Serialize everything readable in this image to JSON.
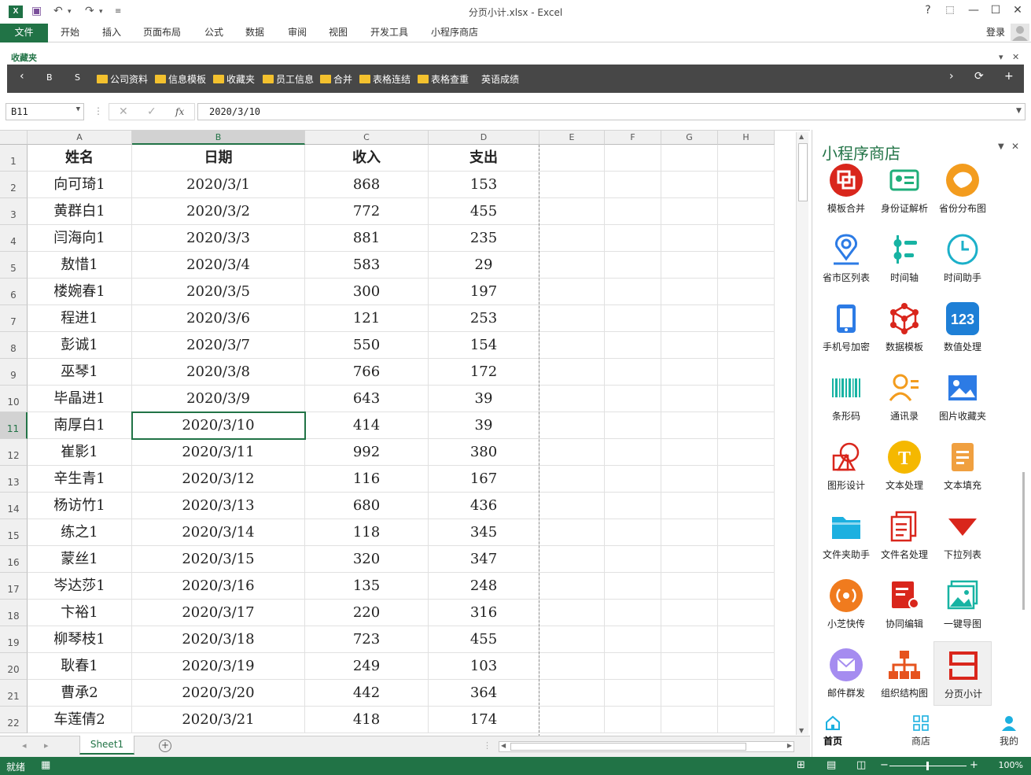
{
  "window": {
    "title": "分页小计.xlsx - Excel",
    "controls": [
      "?",
      "⬚",
      "—",
      "☐",
      "✕"
    ]
  },
  "ribbon": {
    "file": "文件",
    "tabs": [
      "开始",
      "插入",
      "页面布局",
      "公式",
      "数据",
      "审阅",
      "视图",
      "开发工具",
      "小程序商店"
    ],
    "login": "登录"
  },
  "favorites": {
    "label": "收藏夹",
    "buttons": [
      "‹",
      "B",
      "S"
    ],
    "items": [
      "公司资料",
      "信息模板",
      "收藏夹",
      "员工信息",
      "合并",
      "表格连结",
      "表格查重",
      "英语成绩"
    ],
    "right_buttons": [
      "›",
      "⟳",
      "+"
    ]
  },
  "formula_bar": {
    "name_box": "B11",
    "cancel": "✕",
    "confirm": "✓",
    "fx": "fx",
    "value": "2020/3/10"
  },
  "sheet": {
    "columns": [
      "A",
      "B",
      "C",
      "D",
      "E",
      "F",
      "G",
      "H"
    ],
    "selected_column": "B",
    "selected_row": 11,
    "active_cell": "B11",
    "header": [
      "姓名",
      "日期",
      "收入",
      "支出"
    ],
    "rows": [
      [
        "向可琦1",
        "2020/3/1",
        "868",
        "153"
      ],
      [
        "黄群白1",
        "2020/3/2",
        "772",
        "455"
      ],
      [
        "闫海向1",
        "2020/3/3",
        "881",
        "235"
      ],
      [
        "敖惜1",
        "2020/3/4",
        "583",
        "29"
      ],
      [
        "楼婉春1",
        "2020/3/5",
        "300",
        "197"
      ],
      [
        "程进1",
        "2020/3/6",
        "121",
        "253"
      ],
      [
        "彭诚1",
        "2020/3/7",
        "550",
        "154"
      ],
      [
        "巫琴1",
        "2020/3/8",
        "766",
        "172"
      ],
      [
        "毕晶进1",
        "2020/3/9",
        "643",
        "39"
      ],
      [
        "南厚白1",
        "2020/3/10",
        "414",
        "39"
      ],
      [
        "崔影1",
        "2020/3/11",
        "992",
        "380"
      ],
      [
        "辛生青1",
        "2020/3/12",
        "116",
        "167"
      ],
      [
        "杨访竹1",
        "2020/3/13",
        "680",
        "436"
      ],
      [
        "练之1",
        "2020/3/14",
        "118",
        "345"
      ],
      [
        "蒙丝1",
        "2020/3/15",
        "320",
        "347"
      ],
      [
        "岑达莎1",
        "2020/3/16",
        "135",
        "248"
      ],
      [
        "卞裕1",
        "2020/3/17",
        "220",
        "316"
      ],
      [
        "柳琴枝1",
        "2020/3/18",
        "723",
        "455"
      ],
      [
        "耿春1",
        "2020/3/19",
        "249",
        "103"
      ],
      [
        "曹承2",
        "2020/3/20",
        "442",
        "364"
      ],
      [
        "车莲倩2",
        "2020/3/21",
        "418",
        "174"
      ]
    ],
    "row_numbers": [
      "1",
      "2",
      "3",
      "4",
      "5",
      "6",
      "7",
      "8",
      "9",
      "10",
      "11",
      "12",
      "13",
      "14",
      "15",
      "16",
      "17",
      "18",
      "19",
      "20",
      "21",
      "22"
    ],
    "tab": "Sheet1",
    "add_sheet": "+"
  },
  "status": {
    "ready": "就绪",
    "zoom": "100%",
    "zoom_minus": "−",
    "zoom_plus": "+"
  },
  "panel": {
    "title": "小程序商店",
    "apps": [
      {
        "label": "模板合并",
        "icon": "template-merge-icon",
        "color": "#d9261c"
      },
      {
        "label": "身份证解析",
        "icon": "id-card-icon",
        "color": "#1fae7a"
      },
      {
        "label": "省份分布图",
        "icon": "china-map-icon",
        "color": "#f39c1e"
      },
      {
        "label": "省市区列表",
        "icon": "location-pin-icon",
        "color": "#2c7be5"
      },
      {
        "label": "时间轴",
        "icon": "timeline-icon",
        "color": "#17b3a3"
      },
      {
        "label": "时间助手",
        "icon": "clock-icon",
        "color": "#1cb0c9"
      },
      {
        "label": "手机号加密",
        "icon": "phone-icon",
        "color": "#2c7be5"
      },
      {
        "label": "数据模板",
        "icon": "network-icon",
        "color": "#d9261c"
      },
      {
        "label": "数值处理",
        "icon": "number-123-icon",
        "color": "#1e7fd6"
      },
      {
        "label": "条形码",
        "icon": "barcode-icon",
        "color": "#17b3a3"
      },
      {
        "label": "通讯录",
        "icon": "contacts-icon",
        "color": "#f39c1e"
      },
      {
        "label": "图片收藏夹",
        "icon": "picture-icon",
        "color": "#2c7be5"
      },
      {
        "label": "图形设计",
        "icon": "shapes-icon",
        "color": "#d9261c"
      },
      {
        "label": "文本处理",
        "icon": "text-t-icon",
        "color": "#f5b800"
      },
      {
        "label": "文本填充",
        "icon": "document-icon",
        "color": "#f0a040"
      },
      {
        "label": "文件夹助手",
        "icon": "folder-icon",
        "color": "#1cb0e0"
      },
      {
        "label": "文件名处理",
        "icon": "files-icon",
        "color": "#d9261c"
      },
      {
        "label": "下拉列表",
        "icon": "dropdown-triangle-icon",
        "color": "#d9261c"
      },
      {
        "label": "小芝快传",
        "icon": "broadcast-icon",
        "color": "#f07b1e"
      },
      {
        "label": "协同编辑",
        "icon": "collaborate-icon",
        "color": "#d9261c"
      },
      {
        "label": "一键导图",
        "icon": "export-image-icon",
        "color": "#17b3a3"
      },
      {
        "label": "邮件群发",
        "icon": "mail-icon",
        "color": "#a58cf0"
      },
      {
        "label": "组织结构图",
        "icon": "org-chart-icon",
        "color": "#e6531e"
      },
      {
        "label": "分页小计",
        "icon": "page-subtotal-icon",
        "color": "#d9261c"
      }
    ],
    "nav": [
      {
        "label": "首页",
        "icon": "home-icon"
      },
      {
        "label": "商店",
        "icon": "store-grid-icon"
      },
      {
        "label": "我的",
        "icon": "user-icon"
      }
    ]
  }
}
